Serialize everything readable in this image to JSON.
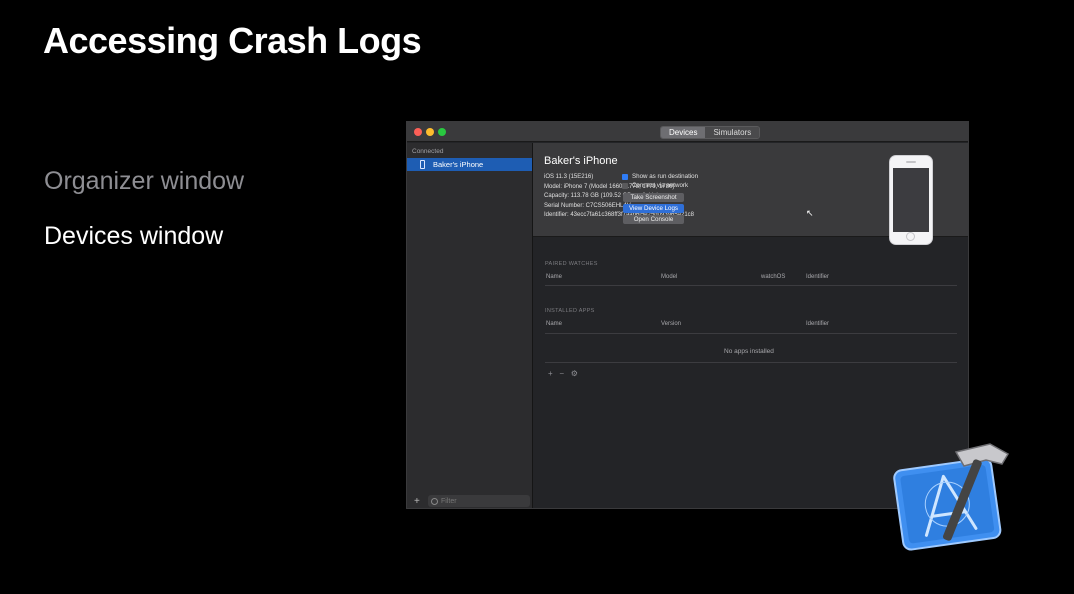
{
  "slide": {
    "title": "Accessing Crash Logs",
    "bullets": [
      "Organizer window",
      "Devices window"
    ]
  },
  "window": {
    "segments": [
      "Devices",
      "Simulators"
    ],
    "selected_segment": "Devices",
    "sidebar": {
      "section": "Connected",
      "device": "Baker's iPhone",
      "filter_placeholder": "Filter",
      "add_symbol": "+"
    },
    "device": {
      "name": "Baker's iPhone",
      "ios": "iOS 11.3 (15E216)",
      "model": "Model: iPhone 7 (Model 1660, 1778, 1779, 1780)",
      "capacity": "Capacity: 113.78 GB (109.52 GB available)",
      "serial": "Serial Number: C7CS506EHL4V",
      "identifier": "Identifier: 43ecc7fa61c368ff3f7aab6f5e25d093965a21c8"
    },
    "options": {
      "show_run_destination": {
        "label": "Show as run destination",
        "checked": true
      },
      "connect_via_network": {
        "label": "Connect via network",
        "checked": false
      }
    },
    "buttons": {
      "screenshot": "Take Screenshot",
      "device_logs": "View Device Logs",
      "console": "Open Console"
    },
    "paired_watches": {
      "title": "PAIRED WATCHES",
      "columns": [
        "Name",
        "Model",
        "watchOS",
        "Identifier"
      ]
    },
    "installed_apps": {
      "title": "INSTALLED APPS",
      "columns": [
        "Name",
        "Version",
        "Identifier"
      ],
      "empty": "No apps installed"
    },
    "toolbar": {
      "add": "+",
      "remove": "−",
      "gear": "⚙"
    }
  },
  "colors": {
    "selection": "#1e5db3",
    "accent_button": "#2f6fd8",
    "checkbox": "#2f7cf6",
    "window_bg": "#232427"
  },
  "icons": [
    "phone-icon",
    "filter-icon",
    "cursor-icon",
    "xcode-app-icon",
    "hammer-icon"
  ]
}
